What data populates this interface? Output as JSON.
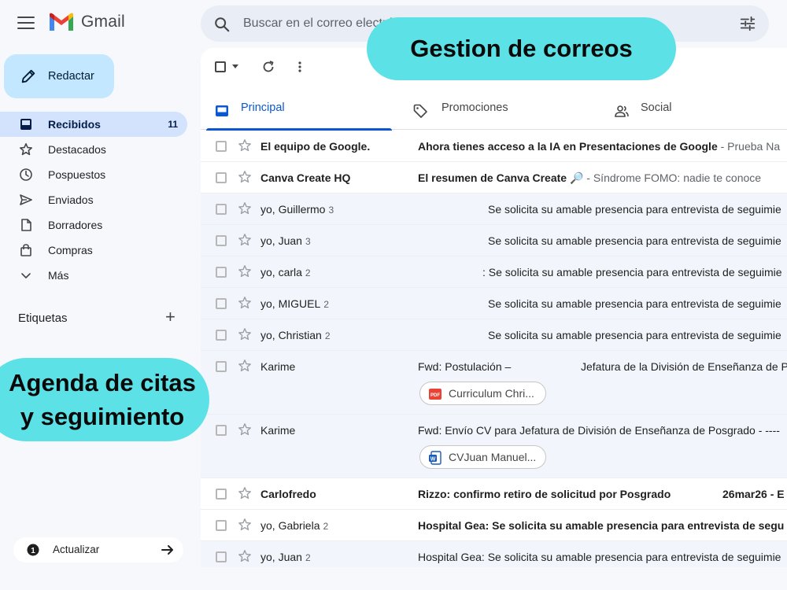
{
  "app": {
    "name": "Gmail",
    "menu_icon": "hamburger-menu-icon",
    "logo_icon": "gmail-m-logo"
  },
  "search": {
    "placeholder": "Buscar en el correo electrónico",
    "icon": "search-icon",
    "filter_icon": "tune-icon"
  },
  "compose": {
    "label": "Redactar",
    "icon": "pencil-icon"
  },
  "sidebar": {
    "items": [
      {
        "label": "Recibidos",
        "icon": "inbox-icon",
        "count": "11",
        "active": true
      },
      {
        "label": "Destacados",
        "icon": "star-icon"
      },
      {
        "label": "Pospuestos",
        "icon": "clock-icon"
      },
      {
        "label": "Enviados",
        "icon": "send-icon"
      },
      {
        "label": "Borradores",
        "icon": "draft-icon"
      },
      {
        "label": "Compras",
        "icon": "shopping-bag-icon"
      },
      {
        "label": "Más",
        "icon": "chevron-down-icon"
      }
    ],
    "labels_heading": "Etiquetas",
    "labels_add": "+",
    "update_label": "Actualizar"
  },
  "tabs": [
    {
      "label": "Principal",
      "icon": "inbox-tab-icon",
      "active": true
    },
    {
      "label": "Promociones",
      "icon": "tag-icon"
    },
    {
      "label": "Social",
      "icon": "people-icon"
    }
  ],
  "emails": [
    {
      "sender": "El equipo de Google.",
      "count": "",
      "subject": "Ahora tienes acceso a la IA en Presentaciones de Google",
      "snippet": " - Prueba Na",
      "unread": true
    },
    {
      "sender": "Canva Create HQ",
      "count": "",
      "subject": "El resumen de Canva Create 🔎",
      "snippet": " - Síndrome FOMO: nadie te conoce",
      "unread": true
    },
    {
      "sender": "yo, Guillermo",
      "count": "3",
      "subject": "Se solicita su amable presencia para entrevista de seguimie",
      "snippet": "",
      "unread": false
    },
    {
      "sender": "yo, Juan",
      "count": "3",
      "subject": "Se solicita su amable presencia para entrevista de seguimie",
      "snippet": "",
      "unread": false
    },
    {
      "sender": "yo, carla",
      "count": "2",
      "subject": ": Se solicita su amable presencia para entrevista de seguimie",
      "snippet": "",
      "unread": false
    },
    {
      "sender": "yo, MIGUEL",
      "count": "2",
      "subject": "Se solicita su amable presencia para entrevista de seguimie",
      "snippet": "",
      "unread": false
    },
    {
      "sender": "yo, Christian",
      "count": "2",
      "subject": "Se solicita su amable presencia para entrevista de seguimie",
      "snippet": "",
      "unread": false
    },
    {
      "sender": "Karime",
      "count": "",
      "subject": "Fwd: Postulación –",
      "extra": "Jefatura de la División de Enseñanza de P",
      "attachment": "Curriculum Chri...",
      "attachment_icon": "pdf-icon",
      "unread": false
    },
    {
      "sender": "Karime",
      "count": "",
      "subject": "Fwd: Envío CV para Jefatura de División de Enseñanza de Posgrado - ----",
      "attachment": "CVJuan Manuel...",
      "attachment_icon": "docx-icon",
      "unread": false
    },
    {
      "sender": "Carlofredo",
      "count": "",
      "subject": "Rizzo: confirmo retiro de solicitud por Posgrado",
      "extra": "26mar26 - E",
      "unread": true
    },
    {
      "sender": "yo, Gabriela",
      "count": "2",
      "subject": "Hospital Gea: Se solicita su amable presencia para entrevista de segu",
      "snippet": "",
      "unread": true
    },
    {
      "sender": "yo, Juan",
      "count": "2",
      "subject": "Hospital Gea: Se solicita su amable presencia para entrevista de seguimie",
      "snippet": "",
      "unread": false
    }
  ],
  "callouts": {
    "top": "Gestion de correos",
    "left_line1": "Agenda de citas",
    "left_line2": "y seguimiento"
  },
  "colors": {
    "accent": "#0b57d0",
    "compose_bg": "#c2e7ff",
    "active_nav_bg": "#d3e3fd",
    "callout_bg": "#5ce1e6"
  }
}
